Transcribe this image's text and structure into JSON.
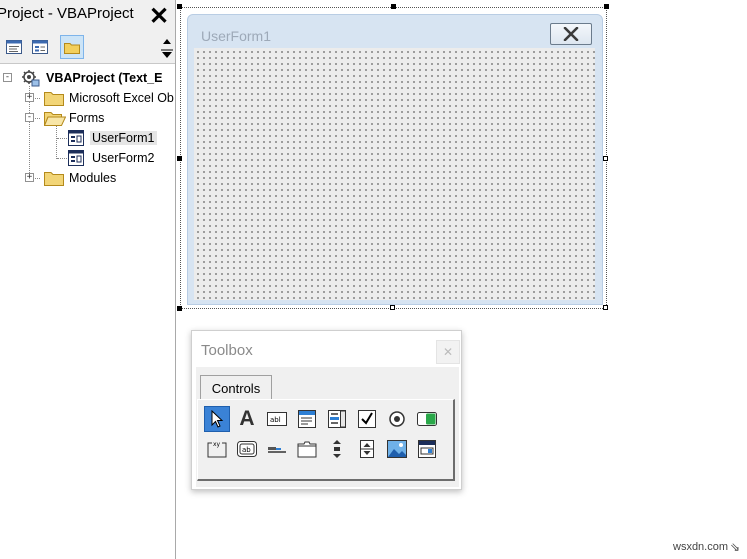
{
  "project_pane": {
    "title": "Project - VBAProject",
    "close_glyph": "✕",
    "toolbar": [
      "view-code-icon",
      "view-object-icon",
      "toggle-folders-icon"
    ],
    "tree": {
      "root": "VBAProject (Text_Extract.xlsm)",
      "root_visible": "VBAProject (Text_E",
      "folders": [
        {
          "label": "Microsoft Excel Objects",
          "visible": "Microsoft Excel Ob",
          "expander": "+"
        },
        {
          "label": "Forms",
          "expander": "-",
          "children": [
            "UserForm1",
            "UserForm2"
          ],
          "selected": "UserForm1"
        },
        {
          "label": "Modules",
          "expander": "+"
        }
      ]
    }
  },
  "designer": {
    "form_caption": "UserForm1",
    "form_background": "#ececec",
    "titlebar_color": "#d7e4f2"
  },
  "toolbox": {
    "title": "Toolbox",
    "close_glyph": "✕",
    "tab_label": "Controls",
    "selected_control": "select-objects-icon",
    "controls_row1": [
      "select-objects-icon",
      "label-icon",
      "textbox-icon",
      "combobox-icon",
      "listbox-icon",
      "checkbox-icon",
      "optionbutton-icon",
      "togglebutton-icon"
    ],
    "controls_row2": [
      "frame-icon",
      "commandbutton-icon",
      "tabstrip-icon",
      "multipage-icon",
      "scrollbar-icon",
      "spinbutton-icon",
      "image-icon",
      "refedit-icon"
    ],
    "label_glyph": "A"
  },
  "watermark": "wsxdn.com",
  "accent_color": "#3a82d6"
}
